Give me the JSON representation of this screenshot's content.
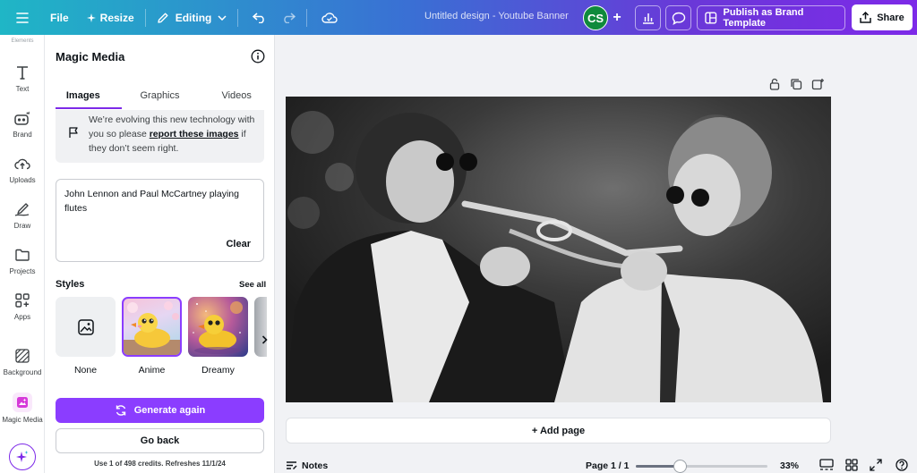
{
  "topbar": {
    "file_label": "File",
    "resize_label": "Resize",
    "editing_label": "Editing",
    "doc_title": "Untitled design - Youtube Banner",
    "avatar_initials": "CS",
    "publish_label": "Publish as Brand Template",
    "share_label": "Share"
  },
  "rail": {
    "cut_label": "Elements",
    "items": [
      {
        "label": "Text",
        "icon": "text-icon"
      },
      {
        "label": "Brand",
        "icon": "brand-icon"
      },
      {
        "label": "Uploads",
        "icon": "upload-cloud-icon"
      },
      {
        "label": "Draw",
        "icon": "draw-icon"
      },
      {
        "label": "Projects",
        "icon": "folder-icon"
      },
      {
        "label": "Apps",
        "icon": "apps-icon"
      },
      {
        "label": "Background",
        "icon": "background-icon"
      },
      {
        "label": "Magic Media",
        "icon": "magic-media-icon"
      }
    ]
  },
  "panel": {
    "title": "Magic Media",
    "tabs": [
      "Images",
      "Graphics",
      "Videos"
    ],
    "active_tab": "Images",
    "notice": {
      "pre": "We’re evolving this new technology with you so please ",
      "link": "report these images",
      "post": " if they don’t seem right."
    },
    "prompt_text": "John Lennon and Paul McCartney playing flutes",
    "clear_label": "Clear",
    "styles_label": "Styles",
    "see_all_label": "See all",
    "styles": [
      {
        "label": "None",
        "selected": false
      },
      {
        "label": "Anime",
        "selected": true
      },
      {
        "label": "Dreamy",
        "selected": false
      }
    ],
    "generate_label": "Generate again",
    "back_label": "Go back",
    "credits_text": "Use 1 of 498 credits. Refreshes 11/1/24"
  },
  "canvas": {
    "add_page_label": "+ Add page"
  },
  "footer": {
    "notes_label": "Notes",
    "page_label": "Page 1 / 1",
    "zoom_label": "33%",
    "zoom_value": 0.33
  },
  "colors": {
    "accent": "#8b3dff",
    "topbar_start": "#1fb6c6",
    "topbar_end": "#7d2ae8"
  }
}
